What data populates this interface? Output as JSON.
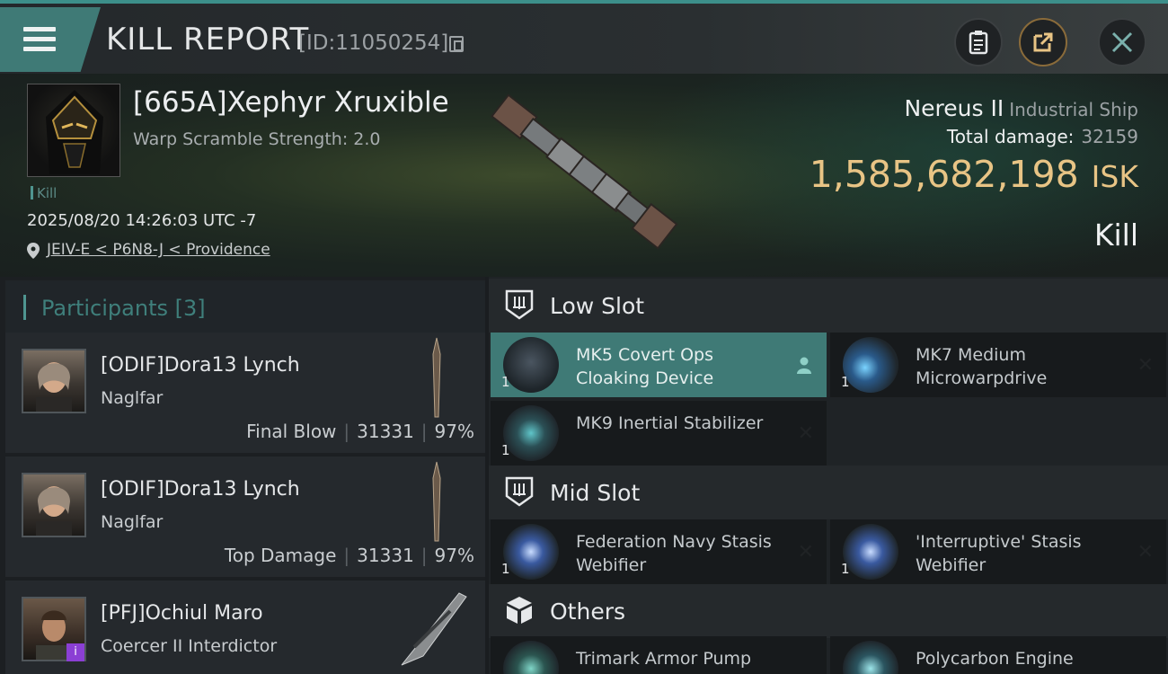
{
  "header": {
    "title": "KILL REPORT",
    "report_id": "[ID:11050254]"
  },
  "victim": {
    "name": "[665A]Xephyr Xruxible",
    "warp_scramble": "Warp Scramble Strength: 2.0",
    "tag": "Kill",
    "datetime": "2025/08/20 14:26:03 UTC -7",
    "location": "JEIV-E < P6N8-J < Providence",
    "ship_name": "Nereus II",
    "ship_class": "Industrial Ship",
    "total_damage_label": "Total damage:",
    "total_damage": "32159",
    "isk_value": "1,585,682,198",
    "isk_unit": "ISK",
    "result": "Kill"
  },
  "participants": {
    "header": "Participants [3]",
    "items": [
      {
        "name": "[ODIF]Dora13 Lynch",
        "ship": "Naglfar",
        "role": "Final Blow",
        "damage": "31331",
        "percent": "97%"
      },
      {
        "name": "[ODIF]Dora13 Lynch",
        "ship": "Naglfar",
        "role": "Top Damage",
        "damage": "31331",
        "percent": "97%"
      },
      {
        "name": "[PFJ]Ochiul Maro",
        "ship": "Coercer II Interdictor",
        "role": "",
        "damage": "",
        "percent": ""
      }
    ]
  },
  "fitting": {
    "low_slot": {
      "label": "Low Slot",
      "modules": [
        {
          "name": "MK5 Covert Ops Cloaking Device",
          "qty": "1"
        },
        {
          "name": "MK7 Medium Microwarpdrive",
          "qty": "1"
        },
        {
          "name": "MK9 Inertial Stabilizer",
          "qty": "1"
        }
      ]
    },
    "mid_slot": {
      "label": "Mid Slot",
      "modules": [
        {
          "name": "Federation Navy Stasis Webifier",
          "qty": "1"
        },
        {
          "name": "'Interruptive' Stasis Webifier",
          "qty": "1"
        }
      ]
    },
    "others": {
      "label": "Others",
      "modules": [
        {
          "name": "Trimark Armor Pump"
        },
        {
          "name": "Polycarbon Engine"
        }
      ]
    }
  },
  "colors": {
    "accent": "#3f7a76",
    "isk": "#e8c485",
    "purple_badge": "#8b3fd4"
  },
  "icons": [
    "menu-icon",
    "copy-icon",
    "clipboard-icon",
    "share-icon",
    "close-icon",
    "location-pin-icon",
    "low-slot-icon",
    "mid-slot-icon",
    "others-cube-icon",
    "person-icon",
    "x-icon"
  ]
}
